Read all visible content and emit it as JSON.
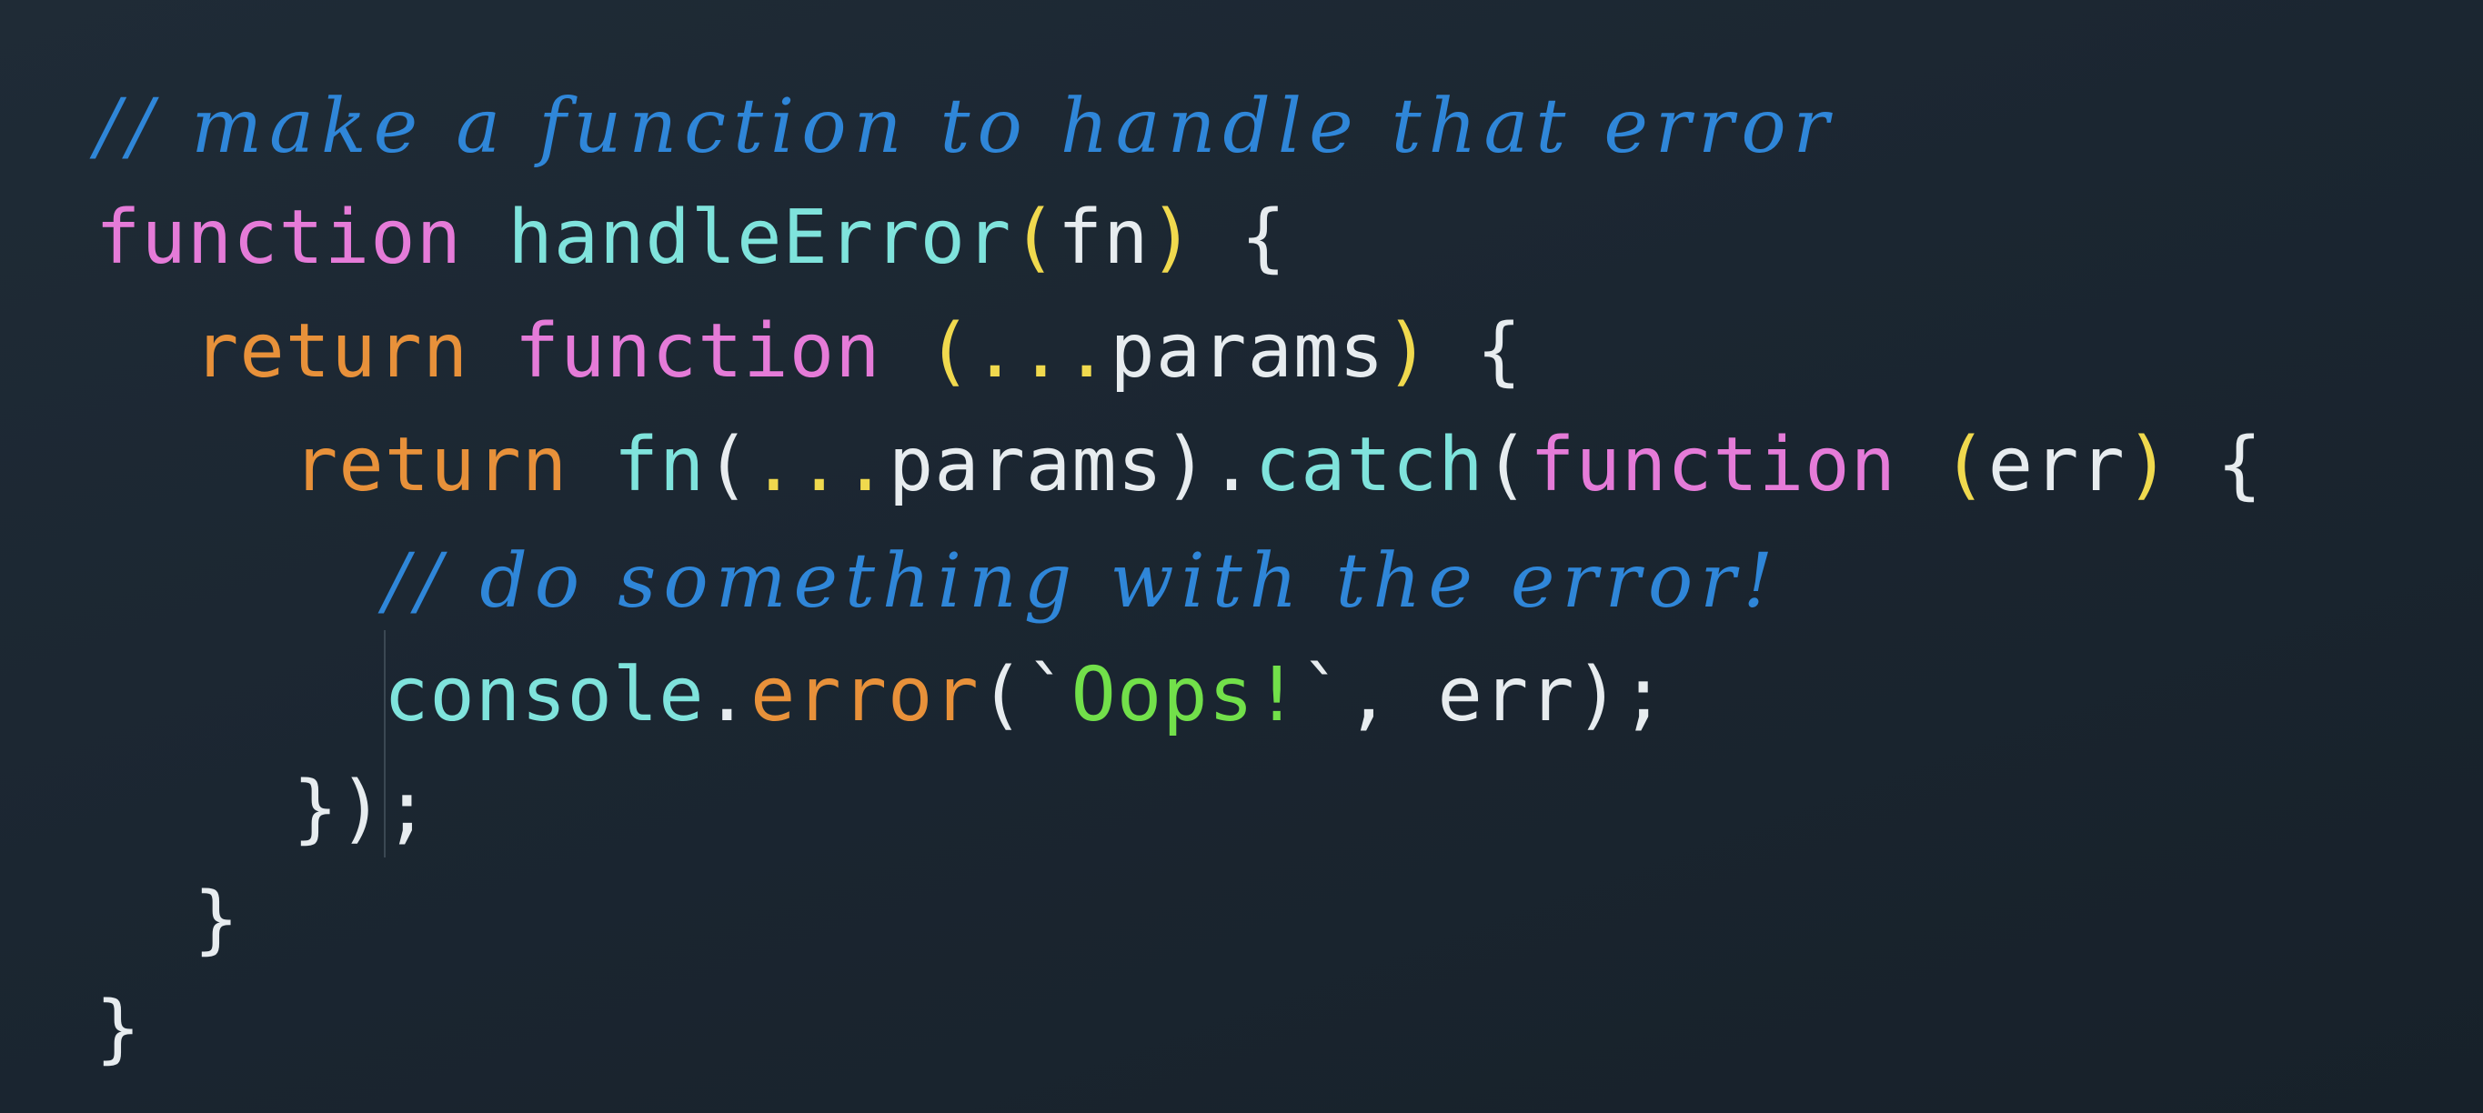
{
  "colors": {
    "background": "#1c2731",
    "comment": "#2f86d8",
    "keyword": "#e57bd8",
    "return": "#e8913a",
    "function_name": "#7fe3dc",
    "paren": "#f0d94e",
    "plain": "#e7ecef",
    "string": "#72e04a",
    "method": "#e8913a"
  },
  "code": {
    "lines": [
      {
        "tokens": [
          {
            "text": "// make a function to handle that error",
            "type": "comment"
          }
        ]
      },
      {
        "tokens": [
          {
            "text": "function",
            "type": "keyword"
          },
          {
            "text": " ",
            "type": "plain"
          },
          {
            "text": "handleError",
            "type": "function_name"
          },
          {
            "text": "(",
            "type": "paren"
          },
          {
            "text": "fn",
            "type": "plain"
          },
          {
            "text": ")",
            "type": "paren"
          },
          {
            "text": " {",
            "type": "plain"
          }
        ]
      },
      {
        "tokens": [
          {
            "text": "return",
            "type": "return"
          },
          {
            "text": " ",
            "type": "plain"
          },
          {
            "text": "function",
            "type": "keyword"
          },
          {
            "text": " ",
            "type": "plain"
          },
          {
            "text": "(",
            "type": "paren"
          },
          {
            "text": "...",
            "type": "paren"
          },
          {
            "text": "params",
            "type": "plain"
          },
          {
            "text": ")",
            "type": "paren"
          },
          {
            "text": " {",
            "type": "plain"
          }
        ]
      },
      {
        "tokens": [
          {
            "text": "return",
            "type": "return"
          },
          {
            "text": " ",
            "type": "plain"
          },
          {
            "text": "fn",
            "type": "function_name"
          },
          {
            "text": "(",
            "type": "plain"
          },
          {
            "text": "...",
            "type": "paren"
          },
          {
            "text": "params).",
            "type": "plain"
          },
          {
            "text": "catch",
            "type": "function_name"
          },
          {
            "text": "(",
            "type": "plain"
          },
          {
            "text": "function",
            "type": "keyword"
          },
          {
            "text": " ",
            "type": "plain"
          },
          {
            "text": "(",
            "type": "paren"
          },
          {
            "text": "err",
            "type": "plain"
          },
          {
            "text": ")",
            "type": "paren"
          },
          {
            "text": " {",
            "type": "plain"
          }
        ]
      },
      {
        "tokens": [
          {
            "text": "// do something with the error!",
            "type": "comment"
          }
        ]
      },
      {
        "tokens": [
          {
            "text": "console",
            "type": "function_name"
          },
          {
            "text": ".",
            "type": "plain"
          },
          {
            "text": "error",
            "type": "method"
          },
          {
            "text": "(`",
            "type": "plain"
          },
          {
            "text": "Oops!",
            "type": "string"
          },
          {
            "text": "`, err);",
            "type": "plain"
          }
        ]
      },
      {
        "tokens": [
          {
            "text": "});",
            "type": "plain"
          }
        ]
      },
      {
        "tokens": [
          {
            "text": "}",
            "type": "plain"
          }
        ]
      },
      {
        "tokens": [
          {
            "text": "}",
            "type": "plain"
          }
        ]
      }
    ]
  }
}
